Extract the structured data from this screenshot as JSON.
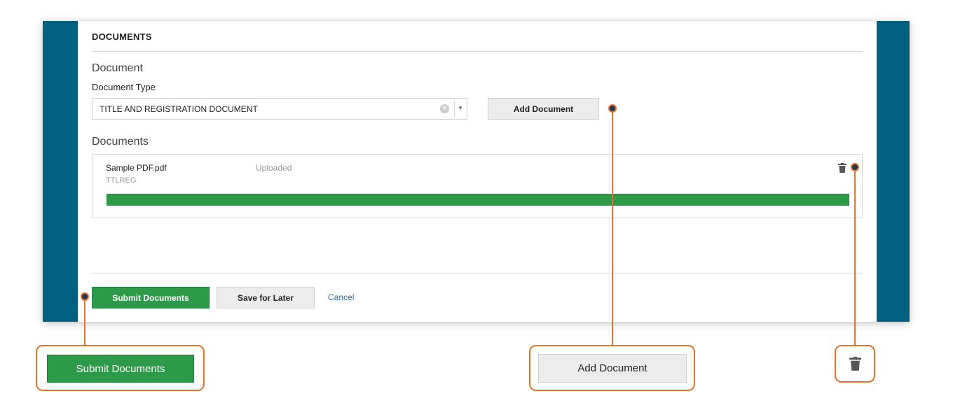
{
  "documents_section": {
    "title": "DOCUMENTS",
    "document_heading": "Document",
    "document_type_label": "Document Type",
    "document_type_value": "TITLE AND REGISTRATION DOCUMENT",
    "add_document_label": "Add Document",
    "documents_heading": "Documents",
    "files": [
      {
        "name": "Sample PDF.pdf",
        "code": "TTLREG",
        "status": "Uploaded",
        "progress_percent": 100
      }
    ]
  },
  "actions": {
    "submit_label": "Submit Documents",
    "save_label": "Save for Later",
    "cancel_label": "Cancel"
  },
  "callouts": {
    "submit_label": "Submit Documents",
    "add_document_label": "Add Document",
    "trash_icon": "trash-icon"
  },
  "colors": {
    "frame": "#01607f",
    "primary_green": "#2d9a4a",
    "callout_orange": "#e8712b"
  }
}
